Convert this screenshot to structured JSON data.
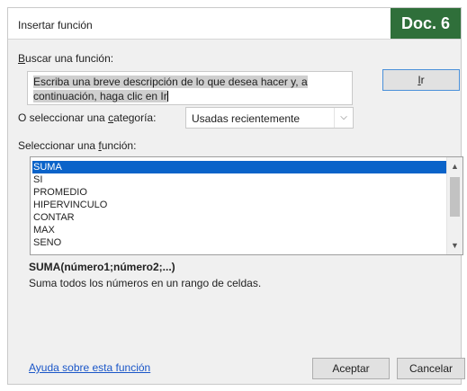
{
  "dialog": {
    "title": "Insertar función",
    "badge": "Doc. 6"
  },
  "search": {
    "label_prefix": "",
    "label_mnemonic": "B",
    "label_rest": "uscar una función:",
    "text_highlighted": "Escriba una breve descripción de lo que desea hacer y, a continuación, haga clic en Ir",
    "go_button": {
      "mnemonic": "I",
      "rest": "r"
    }
  },
  "category": {
    "label_prefix": "O seleccionar una ",
    "label_mnemonic": "c",
    "label_rest": "ategoría:",
    "selected": "Usadas recientemente"
  },
  "function_list": {
    "label_prefix": "Seleccionar una ",
    "label_mnemonic": "f",
    "label_rest": "unción:",
    "items": [
      "SUMA",
      "SI",
      "PROMEDIO",
      "HIPERVINCULO",
      "CONTAR",
      "MAX",
      "SENO"
    ],
    "selected_index": 0
  },
  "selected_function": {
    "signature": "SUMA(número1;número2;...)",
    "description": "Suma todos los números en un rango de celdas."
  },
  "footer": {
    "help_link": "Ayuda sobre esta función",
    "accept_button": "Aceptar",
    "cancel_button": "Cancelar"
  },
  "colors": {
    "badge_bg": "#2f6f3a",
    "selection_bg": "#0a63c9",
    "link": "#1a56c8"
  },
  "icons": [
    "chevron-down-icon",
    "scroll-up-icon",
    "scroll-down-icon"
  ]
}
